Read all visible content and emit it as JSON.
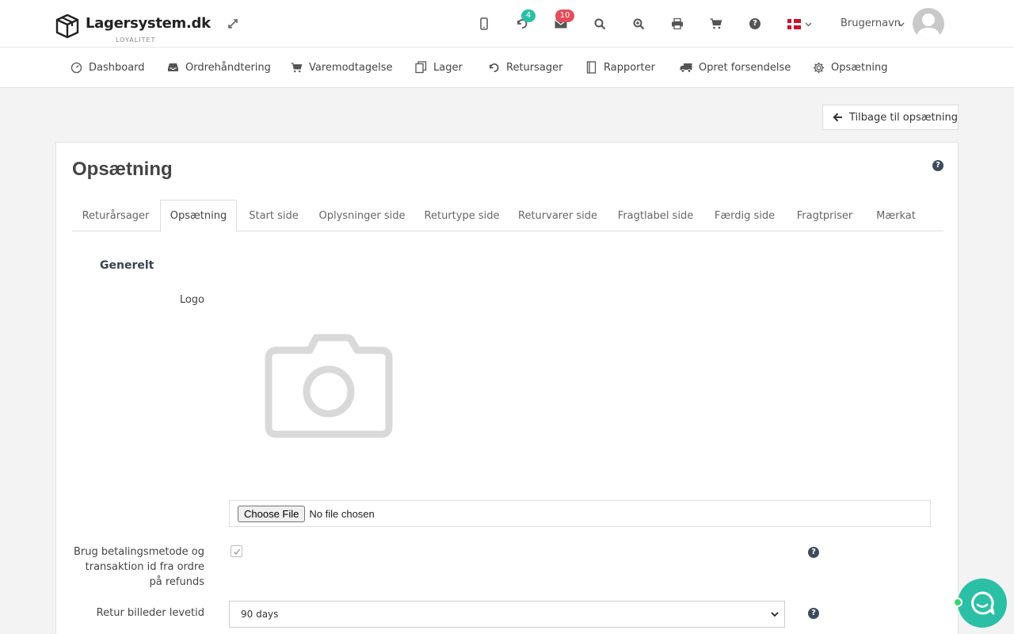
{
  "brand": {
    "name": "Lagersystem.dk",
    "tagline": "LOYALITET"
  },
  "header": {
    "returns_badge": "4",
    "messages_badge": "10",
    "username": "Brugernavn"
  },
  "nav": [
    {
      "label": "Dashboard",
      "icon": "dashboard-icon"
    },
    {
      "label": "Ordrehåndtering",
      "icon": "inbox-icon"
    },
    {
      "label": "Varemodtagelse",
      "icon": "cart-icon"
    },
    {
      "label": "Lager",
      "icon": "copy-icon"
    },
    {
      "label": "Retursager",
      "icon": "undo-icon"
    },
    {
      "label": "Rapporter",
      "icon": "book-icon"
    },
    {
      "label": "Opret forsendelse",
      "icon": "truck-icon"
    },
    {
      "label": "Opsætning",
      "icon": "gear-icon"
    }
  ],
  "back_button": "Tilbage til opsætning",
  "page": {
    "title": "Opsætning",
    "tabs": [
      "Returårsager",
      "Opsætning",
      "Start side",
      "Oplysninger side",
      "Returtype side",
      "Returvarer side",
      "Fragtlabel side",
      "Færdig side",
      "Fragtpriser",
      "Mærkat"
    ],
    "active_tab": "Opsætning",
    "section": "Generelt",
    "logo_label": "Logo",
    "file_button": "Choose File",
    "file_status": "No file chosen",
    "payment_label_1": "Brug betalingsmetode og",
    "payment_label_2": "transaktion id fra ordre",
    "payment_label_3": "på refunds",
    "payment_checked": true,
    "image_lifetime_label": "Retur billeder levetid",
    "image_lifetime_value": "90 days"
  },
  "colors": {
    "accent": "#2bc0a5",
    "badge_red": "#e54c5a",
    "help": "#3d4b5c"
  }
}
